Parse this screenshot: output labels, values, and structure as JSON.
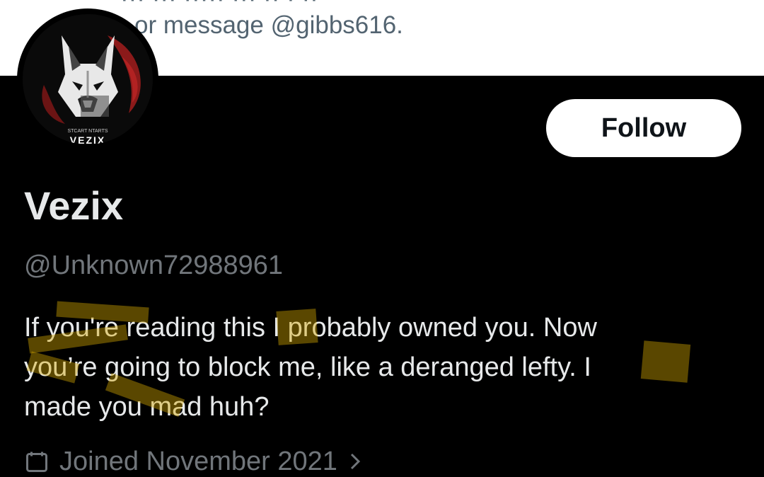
{
  "banner": {
    "text": "or message @gibbs616."
  },
  "avatar": {
    "logo_text": "VEZIX",
    "small_text": "STCART  NTARTS"
  },
  "profile": {
    "follow_label": "Follow",
    "display_name": "Vezix",
    "handle": "@Unknown72988961",
    "bio_lines": [
      "If you're reading this I probably owned you. Now",
      "you’re going to block me, like a deranged lefty.  I",
      "made you mad huh?"
    ],
    "joined": "Joined November 2021"
  },
  "colors": {
    "background": "#000000",
    "banner": "#ffffff",
    "text_primary": "#e7e9ea",
    "text_secondary": "#71767b",
    "highlight": "#d6aa00"
  },
  "icons": {
    "calendar": "calendar-icon",
    "chevron": "chevron-right-icon"
  }
}
